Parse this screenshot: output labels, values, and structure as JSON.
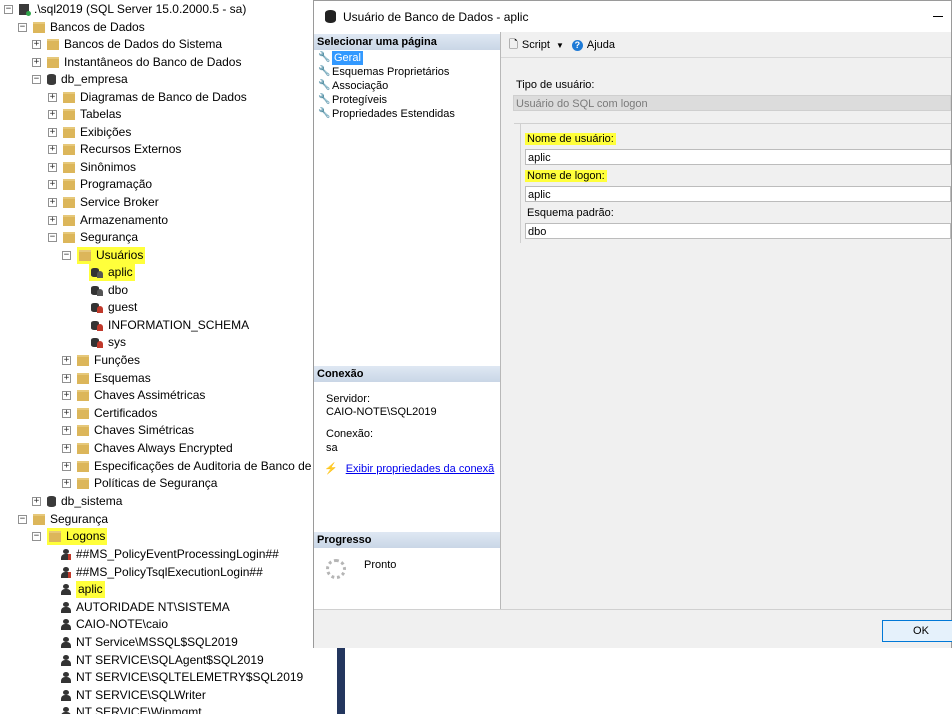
{
  "tree": {
    "server": ".\\sql2019 (SQL Server 15.0.2000.5 - sa)",
    "databases": "Bancos de Dados",
    "system_databases": "Bancos de Dados do Sistema",
    "snapshots": "Instantâneos do Banco de Dados",
    "db_empresa": "db_empresa",
    "db_children": [
      "Diagramas de Banco de Dados",
      "Tabelas",
      "Exibições",
      "Recursos Externos",
      "Sinônimos",
      "Programação",
      "Service Broker",
      "Armazenamento"
    ],
    "seguranca_db": "Segurança",
    "usuarios": "Usuários",
    "users": [
      "aplic",
      "dbo",
      "guest",
      "INFORMATION_SCHEMA",
      "sys"
    ],
    "sec_children": [
      "Funções",
      "Esquemas",
      "Chaves Assimétricas",
      "Certificados",
      "Chaves Simétricas",
      "Chaves Always Encrypted",
      "Especificações de Auditoria de Banco de D",
      "Políticas de Segurança"
    ],
    "db_sistema": "db_sistema",
    "seguranca": "Segurança",
    "logons": "Logons",
    "logins": [
      "##MS_PolicyEventProcessingLogin##",
      "##MS_PolicyTsqlExecutionLogin##",
      "aplic",
      "AUTORIDADE NT\\SISTEMA",
      "CAIO-NOTE\\caio",
      "NT Service\\MSSQL$SQL2019",
      "NT SERVICE\\SQLAgent$SQL2019",
      "NT SERVICE\\SQLTELEMETRY$SQL2019",
      "NT SERVICE\\SQLWriter",
      "NT SERVICE\\Winmgmt"
    ]
  },
  "dialog": {
    "title": "Usuário de Banco de Dados - aplic",
    "select_page": "Selecionar uma página",
    "pages": [
      "Geral",
      "Esquemas Proprietários",
      "Associação",
      "Protegíveis",
      "Propriedades Estendidas"
    ],
    "connection_header": "Conexão",
    "server_label": "Servidor:",
    "server_value": "CAIO-NOTE\\SQL2019",
    "connection_label": "Conexão:",
    "connection_value": "sa",
    "view_props_link": "Exibir propriedades da conexã",
    "progress_header": "Progresso",
    "progress_status": "Pronto",
    "toolbar": {
      "script": "Script",
      "help": "Ajuda"
    },
    "user_type_label": "Tipo de usuário:",
    "user_type_value": "Usuário do SQL com logon",
    "username_label": "Nome de usuário:",
    "username_value": "aplic",
    "login_label": "Nome de logon:",
    "login_value": "aplic",
    "schema_label": "Esquema padrão:",
    "schema_value": "dbo",
    "ok": "OK"
  },
  "colors": {
    "highlight": "#ffff3b",
    "selection": "#3399ff",
    "link": "#0000ee"
  }
}
